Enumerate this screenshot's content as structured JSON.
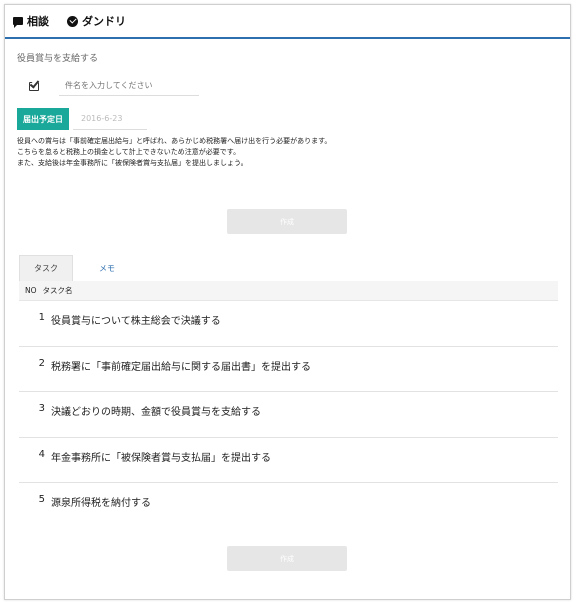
{
  "topnav": {
    "consult_label": "相談",
    "dandori_label": "ダンドリ"
  },
  "form": {
    "section_label": "役員賞与を支給する",
    "title_placeholder": "件名を入力してください",
    "date_label": "届出予定日",
    "date_value": "2016-6-23",
    "description": [
      "役員への賞与は「事前確定届出給与」と呼ばれ、あらかじめ税務署へ届け出を行う必要があります。",
      "こちらを怠ると税務上の損金として計上できないため注意が必要です。",
      "また、支給後は年金事務所に「被保険者賞与支払届」を提出しましょう。"
    ],
    "create_label": "作成"
  },
  "tabs": {
    "task_label": "タスク",
    "memo_label": "メモ"
  },
  "task_table": {
    "col_no": "NO",
    "col_name": "タスク名",
    "rows": [
      {
        "no": "1",
        "name": "役員賞与について株主総会で決議する"
      },
      {
        "no": "2",
        "name": "税務署に「事前確定届出給与に関する届出書」を提出する"
      },
      {
        "no": "3",
        "name": "決議どおりの時期、金額で役員賞与を支給する"
      },
      {
        "no": "4",
        "name": "年金事務所に「被保険者賞与支払届」を提出する"
      },
      {
        "no": "5",
        "name": "源泉所得税を納付する"
      }
    ]
  },
  "bottom": {
    "create_label": "作成"
  },
  "colors": {
    "accent_blue": "#2e6fb0",
    "accent_teal": "#1aa89a",
    "button_disabled": "#e6e6e6"
  }
}
